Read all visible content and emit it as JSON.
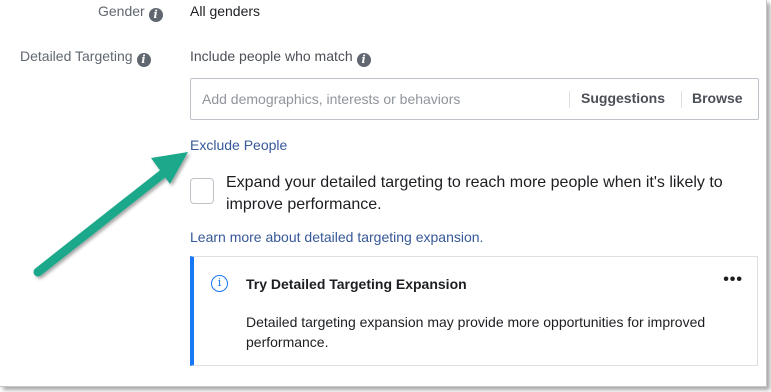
{
  "gender": {
    "label": "Gender",
    "value": "All genders"
  },
  "detailed_targeting": {
    "label": "Detailed Targeting",
    "include_label": "Include people who match",
    "input_placeholder": "Add demographics, interests or behaviors",
    "suggestions_label": "Suggestions",
    "browse_label": "Browse",
    "exclude_link": "Exclude People",
    "expand_text": "Expand your detailed targeting to reach more people when it's likely to improve performance.",
    "expand_checked": false,
    "learn_more_link": "Learn more about detailed targeting expansion."
  },
  "card": {
    "title": "Try Detailed Targeting Expansion",
    "more_label": "•••",
    "body": "Detailed targeting expansion may provide more opportunities for improved performance."
  },
  "colors": {
    "accent": "#1877f2",
    "link": "#365899",
    "annotation_arrow": "#1fa88a"
  },
  "icons": [
    "info-icon",
    "info-circle-icon",
    "more-icon",
    "annotation-arrow"
  ]
}
